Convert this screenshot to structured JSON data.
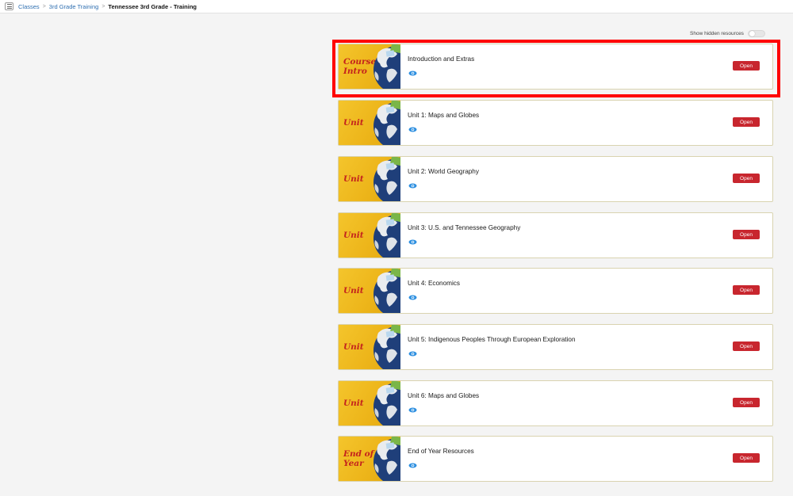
{
  "breadcrumb": {
    "items": [
      "Classes",
      "3rd Grade Training"
    ],
    "current": "Tennessee 3rd Grade - Training"
  },
  "toolbar": {
    "show_hidden_label": "Show hidden resources",
    "show_hidden_on": false
  },
  "open_label": "Open",
  "colors": {
    "accent_red": "#c8262e",
    "link_blue": "#2f6fb1",
    "thumb_gold": "#f4c52c",
    "highlight_red": "#ff0000",
    "eye_blue": "#2d8fe0"
  },
  "resources": [
    {
      "title": "Introduction and Extras",
      "thumb_text": "Course\nIntro",
      "highlighted": true
    },
    {
      "title": "Unit 1: Maps and Globes",
      "thumb_text": "Unit",
      "highlighted": false
    },
    {
      "title": "Unit 2: World Geography",
      "thumb_text": "Unit",
      "highlighted": false
    },
    {
      "title": "Unit 3: U.S. and Tennessee Geography",
      "thumb_text": "Unit",
      "highlighted": false
    },
    {
      "title": "Unit 4: Economics",
      "thumb_text": "Unit",
      "highlighted": false
    },
    {
      "title": "Unit 5: Indigenous Peoples Through European Exploration",
      "thumb_text": "Unit",
      "highlighted": false
    },
    {
      "title": "Unit 6: Maps and Globes",
      "thumb_text": "Unit",
      "highlighted": false
    },
    {
      "title": "End of Year Resources",
      "thumb_text": "End of\nYear",
      "highlighted": false
    }
  ]
}
